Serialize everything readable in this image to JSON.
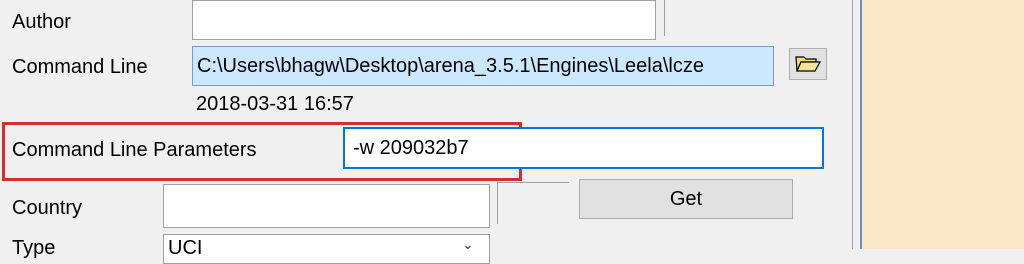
{
  "form": {
    "author_label": "Author",
    "author_value": "",
    "command_line_label": "Command Line",
    "command_line_value": "C:\\Users\\bhagw\\Desktop\\arena_3.5.1\\Engines\\Leela\\lcze",
    "timestamp": "2018-03-31  16:57",
    "params_label": "Command Line Parameters",
    "params_value": "-w 209032b7",
    "country_label": "Country",
    "country_value": "",
    "get_button": "Get",
    "type_label": "Type",
    "type_value": "UCI"
  },
  "colors": {
    "highlight_box": "#d32f2f",
    "side_panel": "#fbe6c8",
    "focus_border": "#0078d7"
  },
  "icons": {
    "browse": "folder-open-icon",
    "dropdown": "chevron-down-icon"
  }
}
